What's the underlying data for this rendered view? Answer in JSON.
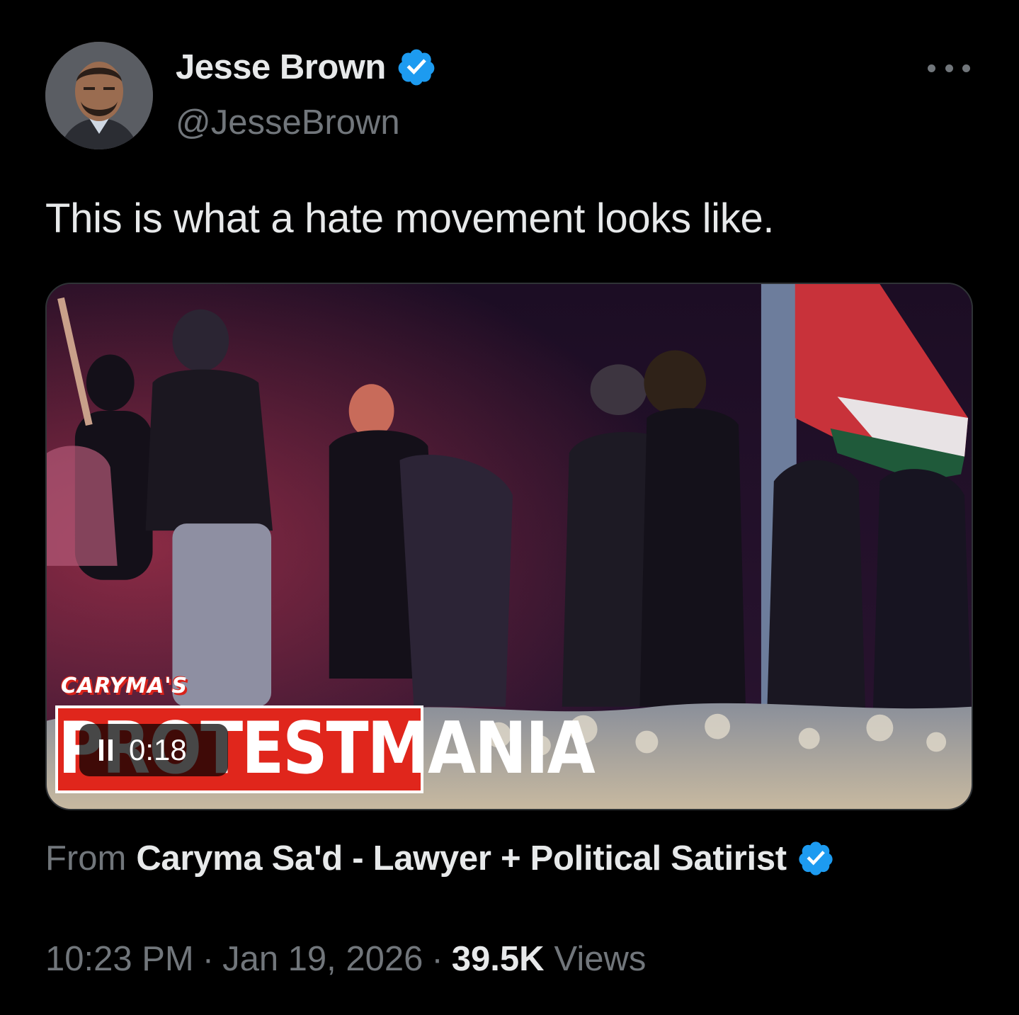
{
  "author": {
    "name": "Jesse Brown",
    "handle": "@JesseBrown",
    "verified": true,
    "verified_color": "#1d9bf0"
  },
  "tweet": {
    "text": "This is what a hate movement looks like."
  },
  "media": {
    "watermark_small": "CARYMA'S",
    "watermark_big": "PROTESTMANIA",
    "watermark_color": "#e0261c",
    "timer": "0:18",
    "pause_icon": "pause-icon"
  },
  "source": {
    "from_label": "From",
    "name": "Caryma Sa'd - Lawyer + Political Satirist",
    "verified": true
  },
  "meta": {
    "time": "10:23 PM",
    "date": "Jan 19, 2026",
    "separator": "·",
    "views_count": "39.5K",
    "views_label": "Views"
  },
  "colors": {
    "background": "#000000",
    "primary_text": "#e7e9ea",
    "secondary_text": "#71767b"
  }
}
